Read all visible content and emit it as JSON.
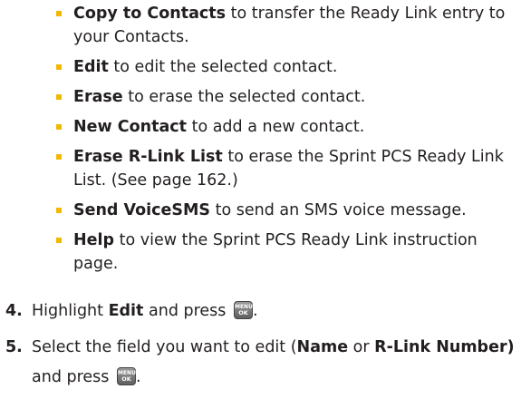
{
  "options": [
    {
      "term": "Copy to Contacts",
      "desc": " to transfer the Ready Link entry to your Contacts."
    },
    {
      "term": "Edit",
      "desc": " to edit the selected contact."
    },
    {
      "term": "Erase",
      "desc": " to erase the selected contact."
    },
    {
      "term": "New Contact",
      "desc": " to add a new contact."
    },
    {
      "term": "Erase R-Link List",
      "desc": " to erase the Sprint PCS Ready Link List. (See page 162.)"
    },
    {
      "term": "Send VoiceSMS",
      "desc": " to send an SMS voice message."
    },
    {
      "term": "Help",
      "desc": " to view the Sprint PCS Ready Link instruction page."
    }
  ],
  "bullet_color": "#f1b800",
  "steps": [
    {
      "number": "4.",
      "pre": "Highlight ",
      "b1": "Edit",
      "post": " and press "
    },
    {
      "number": "5.",
      "pre": "Select the field you want to edit (",
      "b1": "Name",
      "mid": " or ",
      "b2": "R-Link Number)",
      "post": " and press "
    }
  ],
  "key": {
    "icon": "menu-ok-key-icon",
    "line1": "MENU",
    "line2": "OK"
  }
}
